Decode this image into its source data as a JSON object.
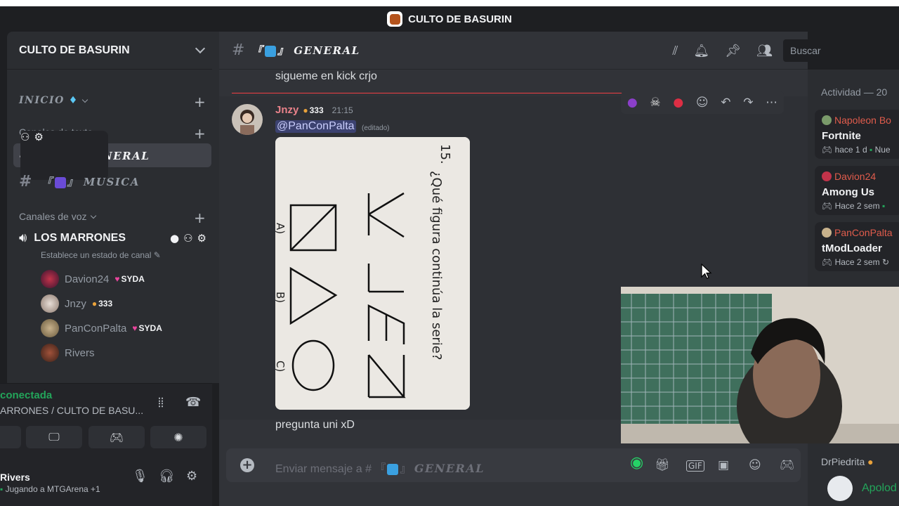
{
  "window": {
    "title": "CULTO DE BASURIN"
  },
  "server": {
    "name": "CULTO DE BASURIN"
  },
  "sidebar": {
    "category_inicio": "INICIO",
    "category_text": "Canales de texto",
    "category_voice": "Canales de voz",
    "text_channels": [
      {
        "prefix": "『",
        "name": "GENERAL",
        "suffix": "』",
        "emoji_color": "#3aa0e0"
      },
      {
        "prefix": "『",
        "name": "MUSICA",
        "suffix": "』",
        "emoji_color": "#6a4bd6"
      }
    ],
    "voice_channel": {
      "name": "LOS MARRONES",
      "status": "Establece un estado de canal"
    },
    "voice_users": [
      {
        "name": "Davion24",
        "badge": "SYDA",
        "badge_type": "heart"
      },
      {
        "name": "Jnzy",
        "badge": "333",
        "badge_type": "emoji"
      },
      {
        "name": "PanConPalta",
        "badge": "SYDA",
        "badge_type": "heart"
      },
      {
        "name": "Rivers",
        "badge": "",
        "badge_type": "none"
      }
    ]
  },
  "voice_panel": {
    "status": "conectada",
    "location": "ARRONES / CULTO DE BASU..."
  },
  "user_panel": {
    "name": "Rivers",
    "status": "Jugando a MTGArena +1"
  },
  "channel_header": {
    "name": "GENERAL",
    "search_placeholder": "Buscar"
  },
  "messages": {
    "prev_text": "sigueme en kick crjo",
    "author": "Jnzy",
    "author_badge": "333",
    "time": "21:15",
    "mention": "@PanConPalta",
    "edited": "(editado)",
    "next_text": "pregunta uni xD"
  },
  "attachment": {
    "number": "15.",
    "question": "¿Qué figura continúa la serie?",
    "options": [
      "A)",
      "B)",
      "C)"
    ]
  },
  "composer": {
    "placeholder_prefix": "Enviar mensaje a #",
    "placeholder_channel": "GENERAL"
  },
  "activity": {
    "header": "Actividad — 20",
    "items": [
      {
        "user": "Napoleon Bo",
        "game": "Fortnite",
        "ago": "hace 1 d",
        "extra": "Nue"
      },
      {
        "user": "Davion24",
        "game": "Among Us",
        "ago": "Hace 2 sem",
        "extra": ""
      },
      {
        "user": "PanConPalta",
        "game": "tModLoader",
        "ago": "Hace 2 sem",
        "extra": ""
      }
    ],
    "footer_user": "DrPiedrita",
    "footer_user2": "Apolod"
  },
  "colors": {
    "accent_green": "#23a55a",
    "danger": "#f23f43",
    "mention_bg": "#3c4270"
  }
}
